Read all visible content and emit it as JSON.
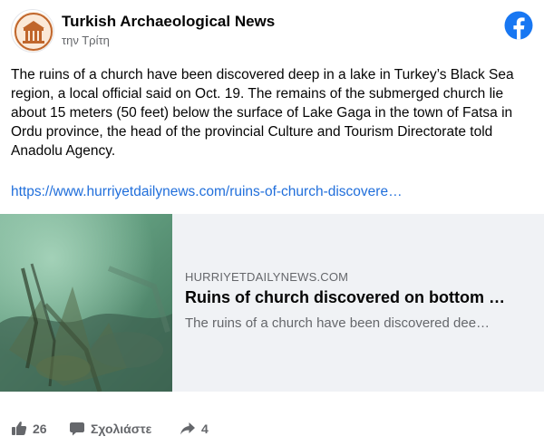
{
  "header": {
    "page_name": "Turkish Archaeological News",
    "time": "την Τρίτη"
  },
  "post": {
    "text": "The ruins of a church have been discovered deep in a lake in Turkey’s Black Sea region, a local official said on Oct. 19. The remains of the submerged church lie about 15 meters (50 feet) below the surface of Lake Gaga in the town of Fatsa in Ordu province, the head of the provincial Culture and Tourism Directorate told Anadolu Agency.",
    "link": "https://www.hurriyetdailynews.com/ruins-of-church-discovere…"
  },
  "preview": {
    "domain": "HURRIYETDAILYNEWS.COM",
    "title": "Ruins of church discovered on bottom …",
    "description": "The ruins of a church have been discovered dee…"
  },
  "actions": {
    "like_count": "26",
    "comment_label": "Σχολιάστε",
    "share_count": "4"
  },
  "icons": {
    "facebook": "facebook-logo-icon",
    "like": "thumbs-up-icon",
    "comment": "comment-icon",
    "share": "share-arrow-icon"
  },
  "colors": {
    "link": "#216fdb",
    "facebook_blue": "#1877f2",
    "secondary_text": "#65676b",
    "preview_bg": "#f0f2f5"
  }
}
